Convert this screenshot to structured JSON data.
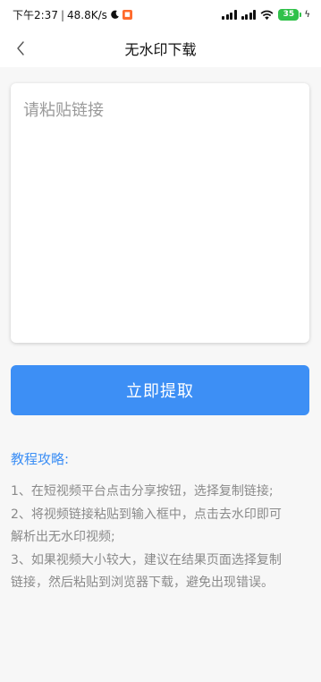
{
  "status_bar": {
    "time": "下午2:37",
    "separator": "|",
    "network_speed": "48.8K/s",
    "battery_level": "35"
  },
  "nav": {
    "title": "无水印下载"
  },
  "input": {
    "placeholder": "请粘贴链接",
    "value": ""
  },
  "submit": {
    "label": "立即提取"
  },
  "guide": {
    "title": "教程攻略:",
    "lines": [
      "1、在短视频平台点击分享按钮，选择复制链接;",
      "2、将视频链接粘贴到输入框中，点击去水印即可",
      "解析出无水印视频;",
      "3、如果视频大小较大，建议在结果页面选择复制",
      "链接，然后粘贴到浏览器下载，避免出现错误。"
    ]
  },
  "colors": {
    "accent": "#3d8ff5",
    "guide_text": "#8a8a8a",
    "battery": "#30c14a"
  }
}
